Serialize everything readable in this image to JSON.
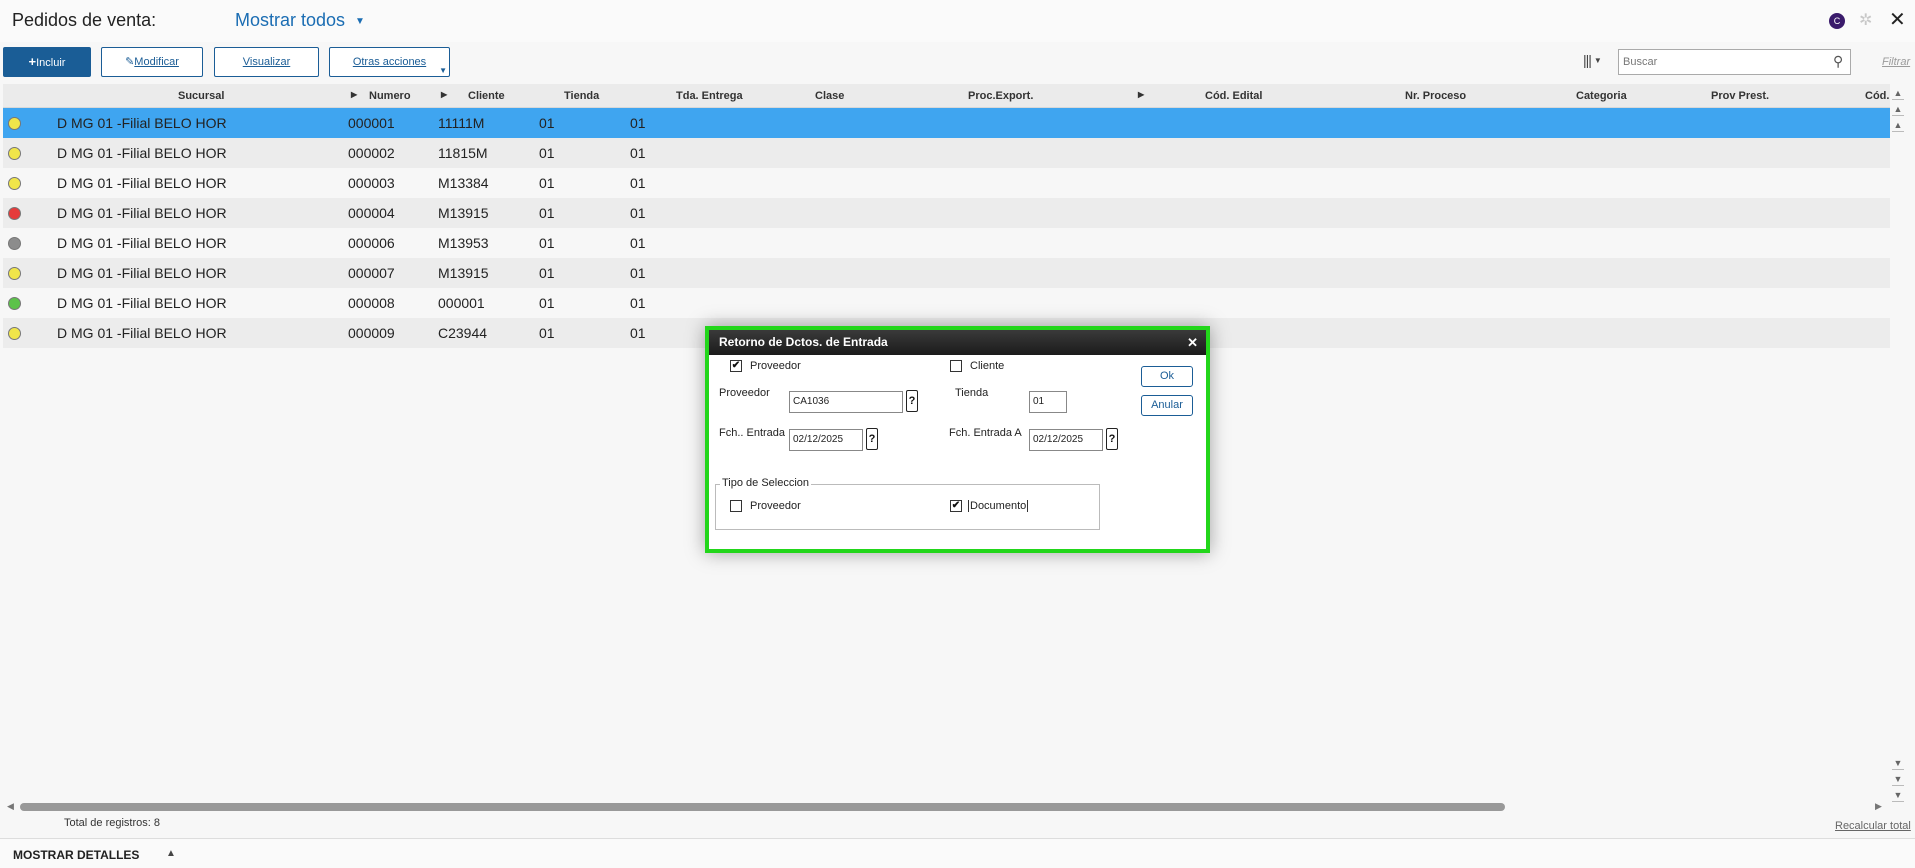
{
  "header": {
    "title": "Pedidos de venta:",
    "view_selector": "Mostrar todos",
    "user_initial": "C"
  },
  "toolbar": {
    "incluir": "Incluir",
    "modificar": "Modificar",
    "visualizar": "Visualizar",
    "otras": "Otras acciones",
    "search_placeholder": "Buscar",
    "filtrar": "Filtrar"
  },
  "columns": [
    "Sucursal",
    "Numero",
    "Cliente",
    "Tienda",
    "Tda. Entrega",
    "Clase",
    "Proc.Export.",
    "Cód. Edital",
    "Nr. Proceso",
    "Categoria",
    "Prov Prest.",
    "Cód."
  ],
  "rows": [
    {
      "status": "yellow",
      "sucursal": "D MG 01 -Filial BELO HOR",
      "numero": "000001",
      "cliente": "11111M",
      "tienda": "01",
      "entrega": "01",
      "selected": true
    },
    {
      "status": "yellow",
      "sucursal": "D MG 01 -Filial BELO HOR",
      "numero": "000002",
      "cliente": "11815M",
      "tienda": "01",
      "entrega": "01"
    },
    {
      "status": "yellow",
      "sucursal": "D MG 01 -Filial BELO HOR",
      "numero": "000003",
      "cliente": "M13384",
      "tienda": "01",
      "entrega": "01"
    },
    {
      "status": "red",
      "sucursal": "D MG 01 -Filial BELO HOR",
      "numero": "000004",
      "cliente": "M13915",
      "tienda": "01",
      "entrega": "01"
    },
    {
      "status": "gray",
      "sucursal": "D MG 01 -Filial BELO HOR",
      "numero": "000006",
      "cliente": "M13953",
      "tienda": "01",
      "entrega": "01"
    },
    {
      "status": "yellow",
      "sucursal": "D MG 01 -Filial BELO HOR",
      "numero": "000007",
      "cliente": "M13915",
      "tienda": "01",
      "entrega": "01"
    },
    {
      "status": "green",
      "sucursal": "D MG 01 -Filial BELO HOR",
      "numero": "000008",
      "cliente": "000001",
      "tienda": "01",
      "entrega": "01"
    },
    {
      "status": "yellow",
      "sucursal": "D MG 01 -Filial BELO HOR",
      "numero": "000009",
      "cliente": "C23944",
      "tienda": "01",
      "entrega": "01"
    }
  ],
  "status_colors": {
    "yellow": "#f0e54a",
    "red": "#e53b3b",
    "gray": "#8c8c8c",
    "green": "#5cc24a"
  },
  "footer": {
    "total": "Total de registros: 8",
    "recalc": "Recalcular total",
    "details": "MOSTRAR DETALLES"
  },
  "dialog": {
    "title": "Retorno de Dctos. de Entrada",
    "chk_proveedor": "Proveedor",
    "chk_proveedor_checked": true,
    "chk_cliente": "Cliente",
    "chk_cliente_checked": false,
    "proveedor_label": "Proveedor",
    "proveedor_value": "CA1036",
    "tienda_label": "Tienda",
    "tienda_value": "01",
    "fch_entrada_label": "Fch.. Entrada",
    "fch_entrada_value": "02/12/2025",
    "fch_entrada_a_label": "Fch. Entrada A",
    "fch_entrada_a_value": "02/12/2025",
    "lookup": "?",
    "ok": "Ok",
    "anular": "Anular",
    "group_title": "Tipo de Seleccion",
    "sel_proveedor": "Proveedor",
    "sel_proveedor_checked": false,
    "sel_documento": "Documento",
    "sel_documento_checked": true,
    "border_color": "#22d61a"
  }
}
